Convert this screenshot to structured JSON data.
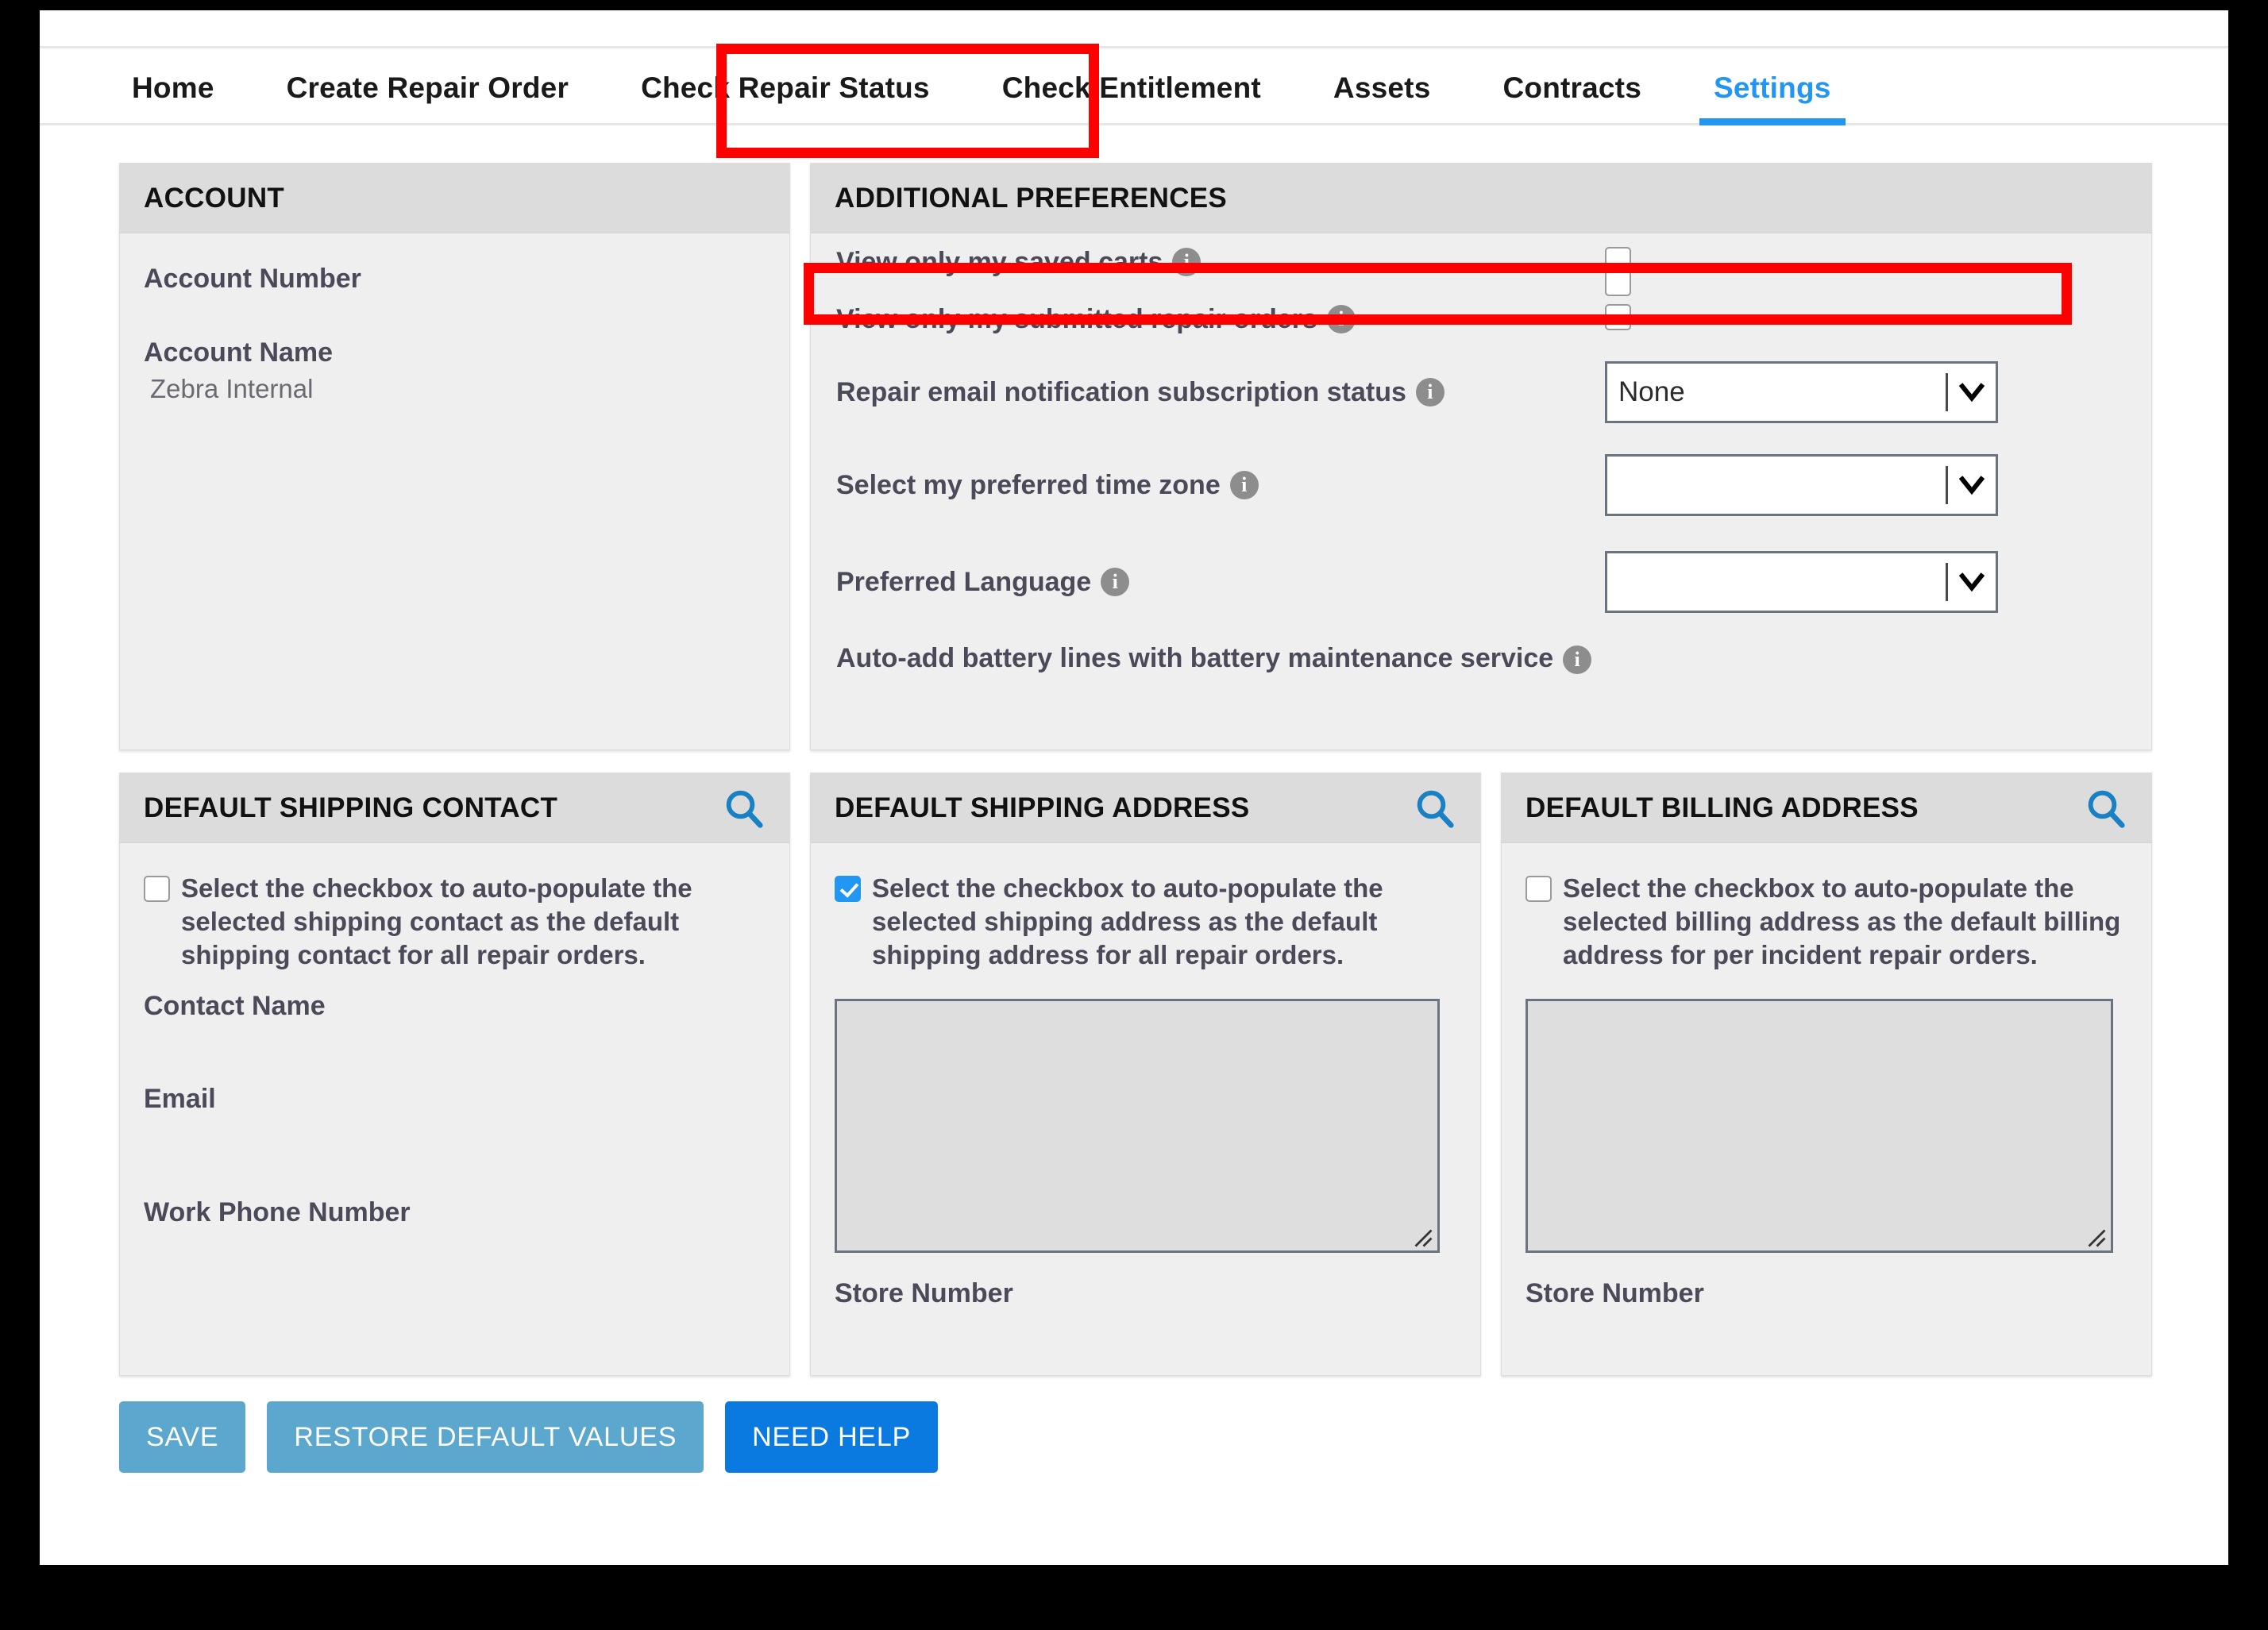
{
  "nav": {
    "items": [
      {
        "label": "Home",
        "active": false
      },
      {
        "label": "Create Repair Order",
        "active": false
      },
      {
        "label": "Check Repair Status",
        "active": false
      },
      {
        "label": "Check Entitlement",
        "active": false
      },
      {
        "label": "Assets",
        "active": false
      },
      {
        "label": "Contracts",
        "active": false
      },
      {
        "label": "Settings",
        "active": true
      }
    ]
  },
  "account": {
    "title": "ACCOUNT",
    "number_label": "Account Number",
    "number_value": "",
    "name_label": "Account Name",
    "name_value": "Zebra Internal"
  },
  "preferences": {
    "title": "ADDITIONAL PREFERENCES",
    "rows": [
      {
        "label": "View only my saved carts",
        "control": "checkbox",
        "checked": false
      },
      {
        "label": "View only my submitted repair orders",
        "control": "checkbox",
        "checked": false
      },
      {
        "label": "Repair email notification subscription status",
        "control": "select",
        "value": "None"
      },
      {
        "label": "Select my preferred time zone",
        "control": "select",
        "value": ""
      },
      {
        "label": "Preferred Language",
        "control": "select",
        "value": ""
      },
      {
        "label": "Auto-add battery lines with battery maintenance service",
        "control": "checkbox",
        "checked": false
      }
    ]
  },
  "shipping_contact": {
    "title": "DEFAULT SHIPPING CONTACT",
    "checkbox_text": "Select the checkbox to auto-populate the selected shipping contact as the default shipping contact for all repair orders.",
    "checked": false,
    "contact_name_label": "Contact Name",
    "contact_name_value": "",
    "email_label": "Email",
    "email_value": "",
    "work_phone_label": "Work Phone Number",
    "work_phone_value": ""
  },
  "shipping_address": {
    "title": "DEFAULT SHIPPING ADDRESS",
    "checkbox_text": "Select the checkbox to auto-populate the selected shipping address as the default shipping address for all repair orders.",
    "checked": true,
    "address_value": "",
    "store_number_label": "Store Number",
    "store_number_value": ""
  },
  "billing_address": {
    "title": "DEFAULT BILLING ADDRESS",
    "checkbox_text": "Select the checkbox to auto-populate the selected billing address as the default billing address for per incident repair orders.",
    "checked": false,
    "address_value": "",
    "store_number_label": "Store Number",
    "store_number_value": ""
  },
  "buttons": {
    "save": "SAVE",
    "restore": "RESTORE DEFAULT VALUES",
    "help": "NEED HELP"
  },
  "colors": {
    "accent": "#2196f3",
    "highlight": "#fe0000",
    "button_secondary": "#5ba7ce",
    "button_primary": "#0a7ae0",
    "panel_header": "#dcdcdc",
    "panel_body": "#efefef"
  },
  "icons": {
    "search": "search-icon",
    "info": "info-icon",
    "chevron_down": "chevron-down-icon"
  }
}
